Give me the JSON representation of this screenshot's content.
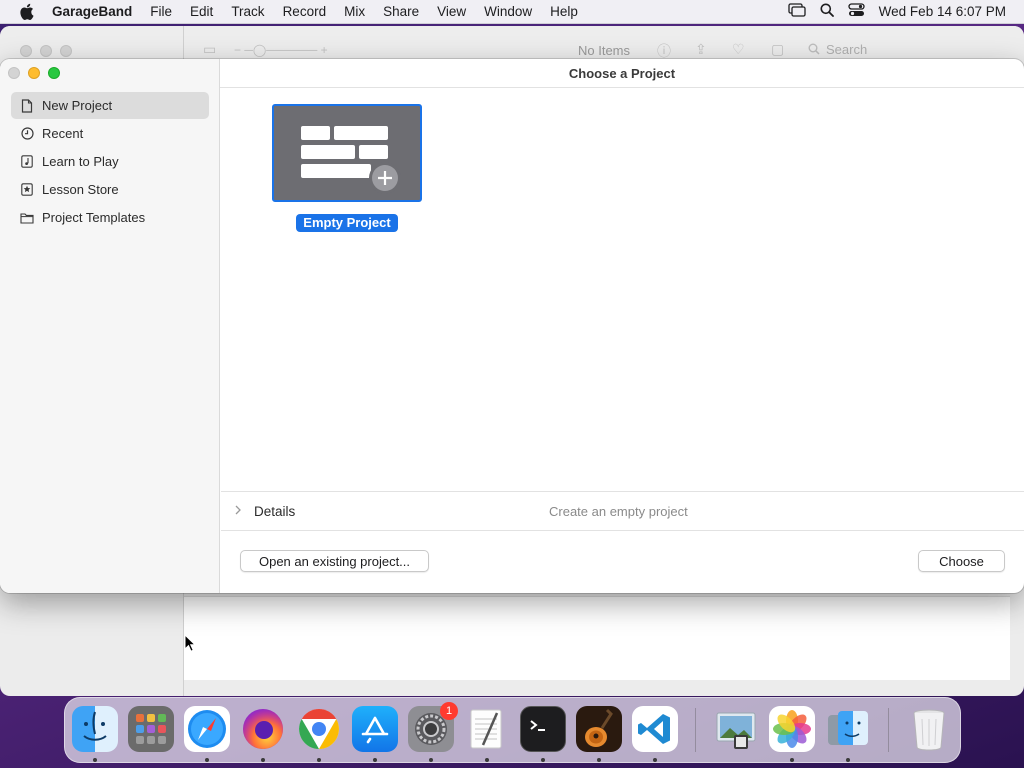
{
  "menubar": {
    "app_name": "GarageBand",
    "items": [
      "File",
      "Edit",
      "Track",
      "Record",
      "Mix",
      "Share",
      "View",
      "Window",
      "Help"
    ],
    "clock": "Wed Feb 14  6:07 PM"
  },
  "background_window": {
    "status_text": "No Items",
    "search_placeholder": "Search"
  },
  "dialog": {
    "title": "Choose a Project",
    "sidebar": [
      {
        "label": "New Project",
        "icon": "document-icon",
        "selected": true
      },
      {
        "label": "Recent",
        "icon": "clock-icon",
        "selected": false
      },
      {
        "label": "Learn to Play",
        "icon": "music-note-icon",
        "selected": false
      },
      {
        "label": "Lesson Store",
        "icon": "star-icon",
        "selected": false
      },
      {
        "label": "Project Templates",
        "icon": "folder-icon",
        "selected": false
      }
    ],
    "templates": [
      {
        "label": "Empty Project",
        "selected": true
      }
    ],
    "details": {
      "label": "Details",
      "description": "Create an empty project"
    },
    "buttons": {
      "open_existing": "Open an existing project...",
      "choose": "Choose"
    },
    "accent_color": "#1a73e8"
  },
  "dock": {
    "apps": [
      {
        "name": "Finder",
        "icon": "finder-icon",
        "running": true
      },
      {
        "name": "Launchpad",
        "icon": "launchpad-icon",
        "running": false
      },
      {
        "name": "Safari",
        "icon": "safari-icon",
        "running": true
      },
      {
        "name": "Firefox",
        "icon": "firefox-icon",
        "running": true
      },
      {
        "name": "Chrome",
        "icon": "chrome-icon",
        "running": true
      },
      {
        "name": "App Store",
        "icon": "app-store-icon",
        "running": true
      },
      {
        "name": "System Settings",
        "icon": "settings-icon",
        "running": true,
        "badge": "1"
      },
      {
        "name": "TextEdit",
        "icon": "textedit-icon",
        "running": true
      },
      {
        "name": "Terminal",
        "icon": "terminal-icon",
        "running": true
      },
      {
        "name": "GarageBand",
        "icon": "garageband-icon",
        "running": true
      },
      {
        "name": "VS Code",
        "icon": "vscode-icon",
        "running": true
      },
      {
        "name": "Preview",
        "icon": "preview-icon",
        "running": false
      },
      {
        "name": "Photos",
        "icon": "photos-icon",
        "running": true
      },
      {
        "name": "Finder Folder",
        "icon": "folder-finder-icon",
        "running": true
      },
      {
        "name": "Trash",
        "icon": "trash-icon",
        "running": false
      }
    ]
  }
}
